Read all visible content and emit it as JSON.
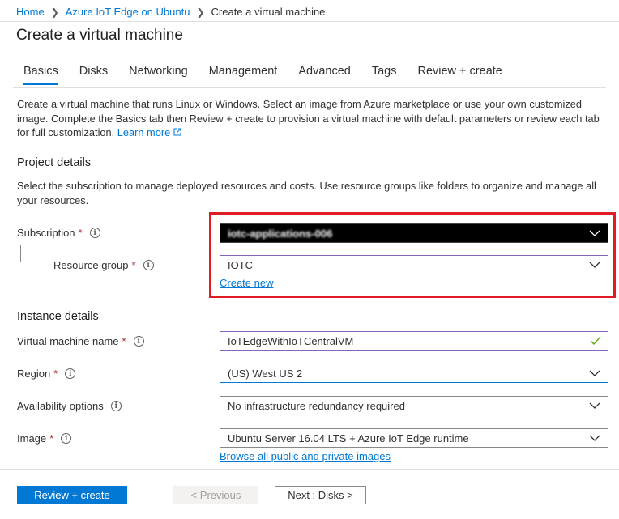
{
  "breadcrumb": {
    "items": [
      "Home",
      "Azure IoT Edge on Ubuntu"
    ],
    "current": "Create a virtual machine"
  },
  "page": {
    "title": "Create a virtual machine"
  },
  "tabs": [
    {
      "label": "Basics",
      "active": true
    },
    {
      "label": "Disks"
    },
    {
      "label": "Networking"
    },
    {
      "label": "Management"
    },
    {
      "label": "Advanced"
    },
    {
      "label": "Tags"
    },
    {
      "label": "Review + create"
    }
  ],
  "intro": {
    "text": "Create a virtual machine that runs Linux or Windows. Select an image from Azure marketplace or use your own customized image. Complete the Basics tab then Review + create to provision a virtual machine with default parameters or review each tab for full customization.",
    "learn_more": "Learn more"
  },
  "project": {
    "heading": "Project details",
    "description": "Select the subscription to manage deployed resources and costs. Use resource groups like folders to organize and manage all your resources.",
    "subscription_label": "Subscription",
    "subscription_value": "iotc-applications-006",
    "resource_group_label": "Resource group",
    "resource_group_value": "IOTC",
    "create_new": "Create new"
  },
  "instance": {
    "heading": "Instance details",
    "vm_name_label": "Virtual machine name",
    "vm_name_value": "IoTEdgeWithIoTCentralVM",
    "region_label": "Region",
    "region_value": "(US) West US 2",
    "availability_label": "Availability options",
    "availability_value": "No infrastructure redundancy required",
    "image_label": "Image",
    "image_value": "Ubuntu Server 16.04 LTS + Azure IoT Edge runtime",
    "browse_images": "Browse all public and private images"
  },
  "required_marker": "*",
  "info_glyph": "i",
  "footer": {
    "review_create": "Review + create",
    "previous": "< Previous",
    "next": "Next : Disks >"
  },
  "colors": {
    "accent": "#0078d4",
    "highlight": "#e11b22",
    "required": "#a4262c",
    "focus_purple": "#8764b8",
    "valid_green": "#57a300"
  }
}
